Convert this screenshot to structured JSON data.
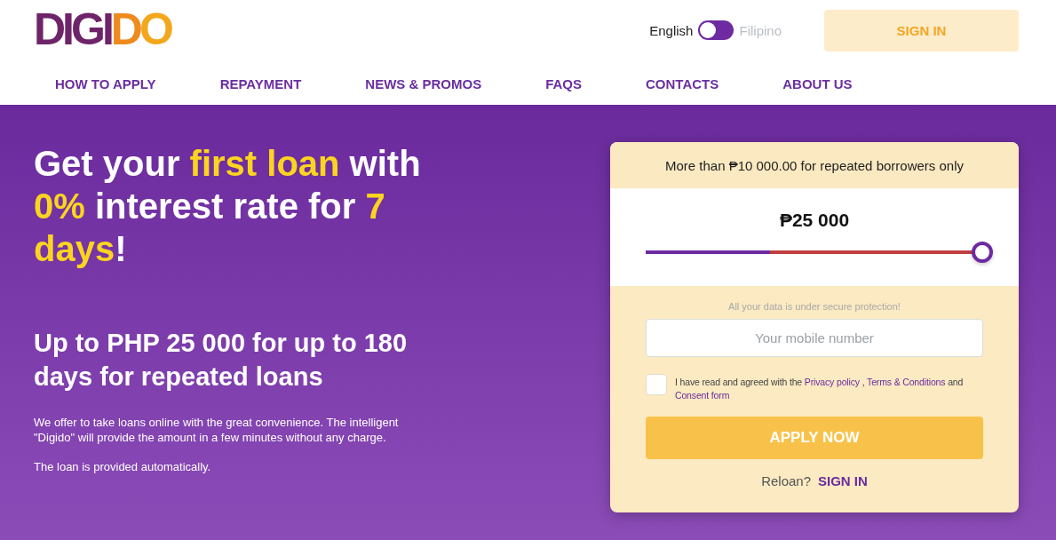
{
  "header": {
    "logo": {
      "parts": [
        {
          "text": "DIGI",
          "color": "#6e2469"
        },
        {
          "text": "D",
          "color": "#ee8a1e"
        },
        {
          "text": "O",
          "color": "#f3a71c"
        }
      ]
    },
    "language_switch": {
      "options": [
        {
          "label": "English",
          "selected": true
        },
        {
          "label": "Filipino",
          "selected": false
        }
      ]
    },
    "sign_in_button": "SIGN IN"
  },
  "nav": [
    "HOW TO APPLY",
    "REPAYMENT",
    "NEWS & PROMOS",
    "FAQS",
    "CONTACTS",
    "ABOUT US"
  ],
  "hero": {
    "headline": [
      {
        "text": "Get your ",
        "highlight": false
      },
      {
        "text": "first loan",
        "highlight": true
      },
      {
        "text": " with ",
        "highlight": false
      },
      {
        "text": "0%",
        "highlight": true
      },
      {
        "text": " interest rate for ",
        "highlight": false
      },
      {
        "text": "7 days",
        "highlight": true
      },
      {
        "text": "!",
        "highlight": false
      }
    ],
    "subheading": "Up to PHP 25 000 for up to 180 days for repeated loans",
    "paragraphs": [
      "We offer to take loans online with the great convenience. The intelligent \"Digido\" will provide the amount in a few minutes without any charge.",
      "The loan is provided automatically."
    ]
  },
  "loan_card": {
    "notice": "More than ₱10 000.00 for repeated borrowers only",
    "amount": "₱25 000",
    "slider": {
      "level": 1,
      "first_loan_range": {
        "level": 0.37
      }
    },
    "security_note": "All your data is under secure protection!",
    "phone_field": {
      "placeholder": "Your mobile number"
    },
    "consent": {
      "checked": false,
      "parts": [
        {
          "kind": "text",
          "text": "I have read and agreed with the "
        },
        {
          "kind": "link",
          "text": "Privacy policy"
        },
        {
          "kind": "text",
          "text": " , "
        },
        {
          "kind": "link",
          "text": "Terms & Conditions"
        },
        {
          "kind": "text",
          "text": " and "
        },
        {
          "kind": "link",
          "text": "Consent form"
        }
      ]
    },
    "apply_button": "APPLY NOW",
    "reloan": {
      "label": "Reloan?",
      "link": "SIGN IN"
    }
  }
}
